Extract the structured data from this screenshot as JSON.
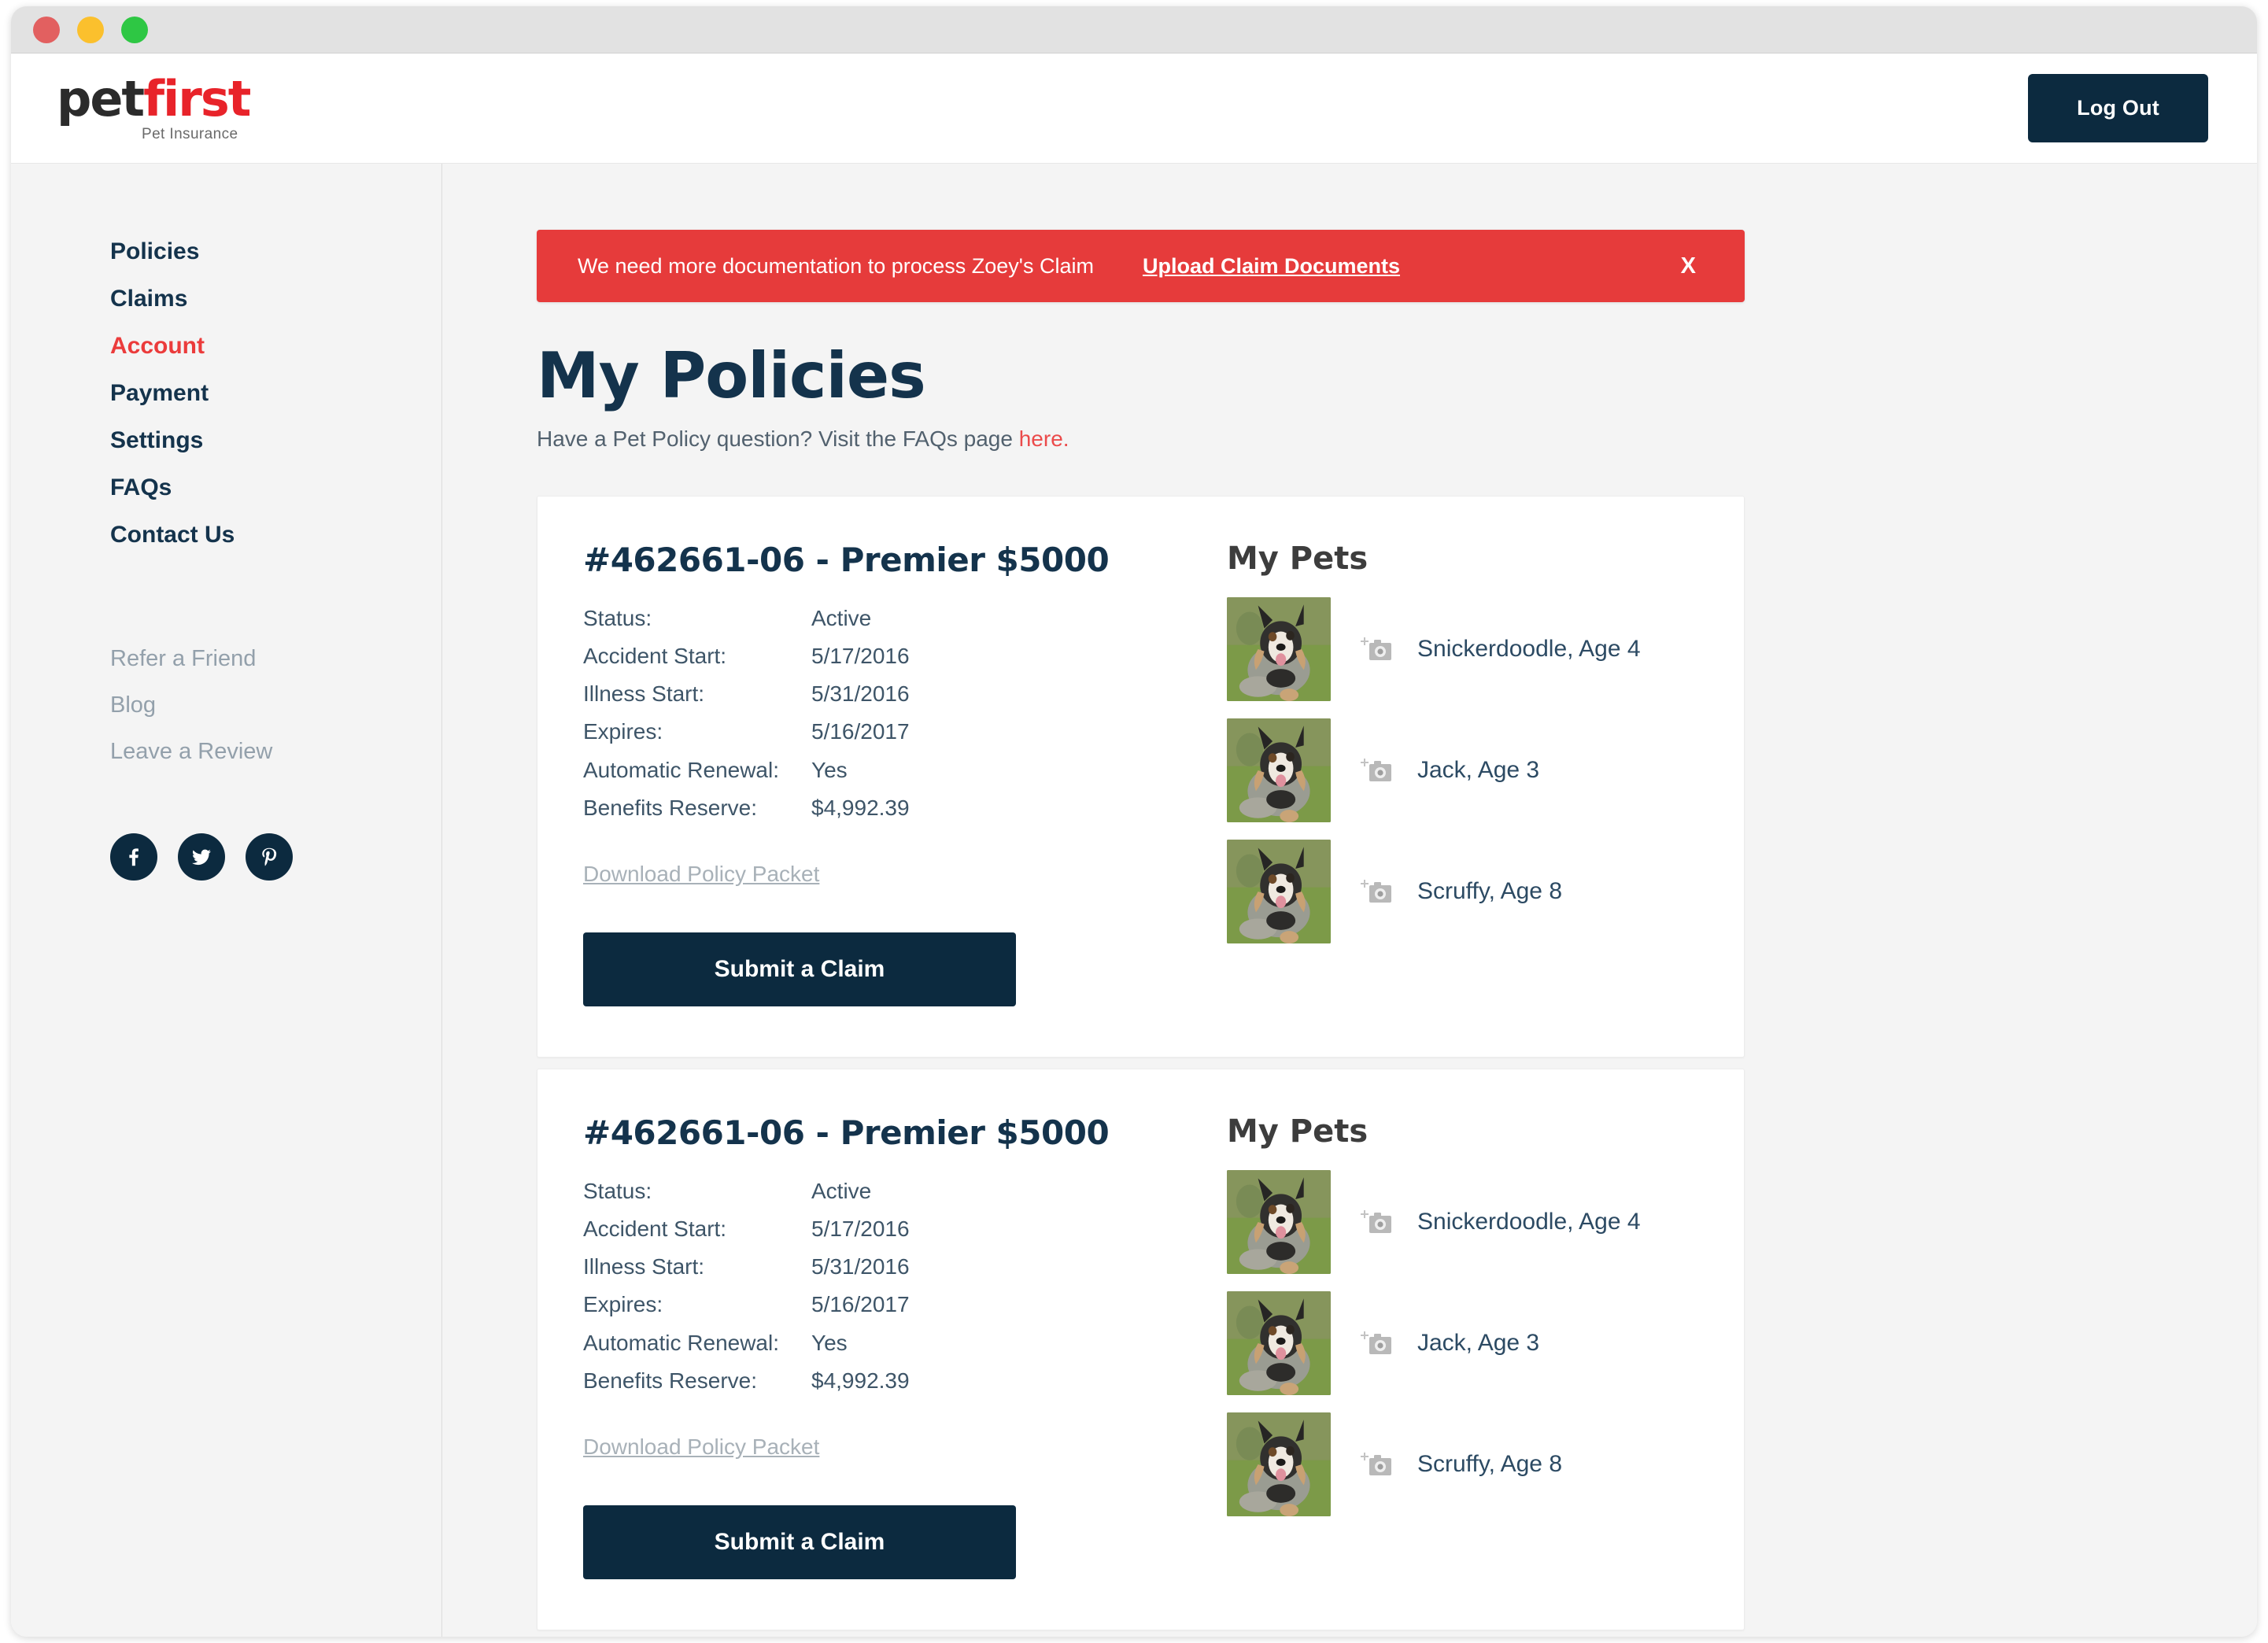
{
  "window": {
    "traffic_lights": [
      {
        "name": "close",
        "color": "#e26060"
      },
      {
        "name": "minimize",
        "color": "#fbc02d"
      },
      {
        "name": "zoom",
        "color": "#2ec744"
      }
    ]
  },
  "header": {
    "logo": {
      "part1": "pet",
      "part2": "first",
      "tagline": "Pet Insurance"
    },
    "logout_label": "Log Out"
  },
  "sidebar": {
    "primary": [
      {
        "label": "Policies",
        "active": false
      },
      {
        "label": "Claims",
        "active": false
      },
      {
        "label": "Account",
        "active": true
      },
      {
        "label": "Payment",
        "active": false
      },
      {
        "label": "Settings",
        "active": false
      },
      {
        "label": "FAQs",
        "active": false
      },
      {
        "label": "Contact Us",
        "active": false
      }
    ],
    "secondary": [
      {
        "label": "Refer a Friend"
      },
      {
        "label": "Blog"
      },
      {
        "label": "Leave a Review"
      }
    ],
    "social": [
      {
        "name": "facebook"
      },
      {
        "name": "twitter"
      },
      {
        "name": "pinterest"
      }
    ]
  },
  "alert": {
    "message": "We need more documentation to process Zoey's Claim",
    "action_label": "Upload Claim Documents",
    "close_label": "X",
    "background": "#e63b3b"
  },
  "page": {
    "title": "My Policies",
    "subtitle_prefix": "Have a Pet Policy question? Visit the FAQs page ",
    "subtitle_link": "here.",
    "link_color": "#eb4b4b"
  },
  "policies": [
    {
      "heading": "#462661-06 - Premier $5000",
      "details": [
        {
          "key": "Status:",
          "value": "Active"
        },
        {
          "key": "Accident Start:",
          "value": "5/17/2016"
        },
        {
          "key": "Illness Start:",
          "value": "5/31/2016"
        },
        {
          "key": "Expires:",
          "value": "5/16/2017"
        },
        {
          "key": "Automatic Renewal:",
          "value": "Yes"
        },
        {
          "key": "Benefits Reserve:",
          "value": "$4,992.39"
        }
      ],
      "download_label": "Download Policy Packet",
      "submit_label": "Submit a Claim",
      "pets_heading": "My Pets",
      "pets": [
        {
          "label": "Snickerdoodle, Age 4"
        },
        {
          "label": "Jack, Age 3"
        },
        {
          "label": "Scruffy, Age 8"
        }
      ]
    },
    {
      "heading": "#462661-06 - Premier $5000",
      "details": [
        {
          "key": "Status:",
          "value": "Active"
        },
        {
          "key": "Accident Start:",
          "value": "5/17/2016"
        },
        {
          "key": "Illness Start:",
          "value": "5/31/2016"
        },
        {
          "key": "Expires:",
          "value": "5/16/2017"
        },
        {
          "key": "Automatic Renewal:",
          "value": "Yes"
        },
        {
          "key": "Benefits Reserve:",
          "value": "$4,992.39"
        }
      ],
      "download_label": "Download Policy Packet",
      "submit_label": "Submit a Claim",
      "pets_heading": "My Pets",
      "pets": [
        {
          "label": "Snickerdoodle, Age 4"
        },
        {
          "label": "Jack, Age 3"
        },
        {
          "label": "Scruffy, Age 8"
        }
      ]
    }
  ],
  "colors": {
    "brand_red": "#e8232a",
    "navy": "#0c2a3f",
    "heading_navy": "#14334c",
    "muted": "#93a0ab"
  }
}
